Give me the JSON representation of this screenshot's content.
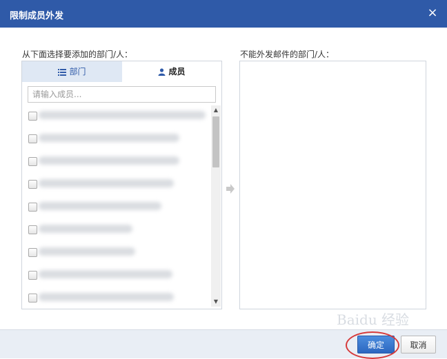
{
  "dialog": {
    "title": "限制成员外发",
    "close_glyph": "×"
  },
  "left_label": "从下面选择要添加的部门/人：",
  "right_label": "不能外发邮件的部门/人：",
  "tabs": [
    {
      "label": "部门",
      "icon": "list-icon"
    },
    {
      "label": "成员",
      "icon": "user-icon"
    }
  ],
  "search": {
    "placeholder": "请输入成员...",
    "value": ""
  },
  "buttons": {
    "confirm": "确定",
    "cancel": "取消"
  },
  "watermark": "Baidu 经验",
  "colors": {
    "title_bar": "#2f5aa8",
    "confirm_button": "#2c67c0",
    "highlight_ring": "#d63a3a"
  }
}
